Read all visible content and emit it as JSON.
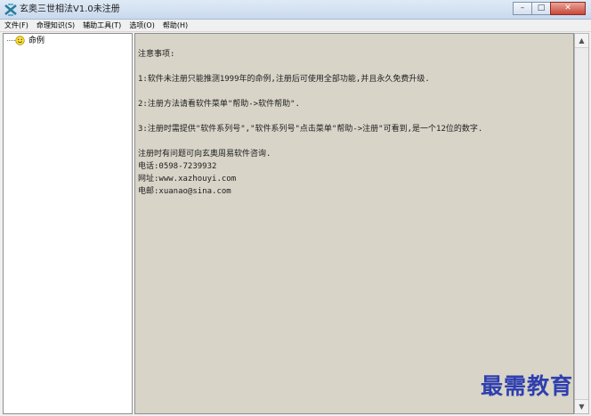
{
  "window": {
    "title": "玄奥三世相法V1.0未注册",
    "buttons": {
      "minimize": "–",
      "maximize": "□",
      "close": "✕"
    }
  },
  "menu": [
    {
      "label": "文件(F)"
    },
    {
      "label": "命理知识(S)"
    },
    {
      "label": "辅助工具(T)"
    },
    {
      "label": "选项(O)"
    },
    {
      "label": "帮助(H)"
    }
  ],
  "tree": {
    "node_label": "命例"
  },
  "notice": {
    "heading": "注意事项:",
    "line1": "1:软件未注册只能推测1999年的命例,注册后可使用全部功能,并且永久免费升级.",
    "line2": "2:注册方法请看软件菜单\"帮助->软件帮助\".",
    "line3": "3:注册时需提供\"软件系列号\",\"软件系列号\"点击菜单\"帮助->注册\"可看到,是一个12位的数字.",
    "contact_intro": "注册时有问题可向玄奥周易软件咨询.",
    "phone": "电话:0598-7239932",
    "website": "网址:www.xazhouyi.com",
    "email": "电邮:xuanao@sina.com"
  },
  "scrollbar": {
    "up": "▲",
    "down": "▼"
  },
  "watermark": "最需教育",
  "colors": {
    "notice_bg": "#d8d4c8",
    "watermark": "#2f3fae"
  }
}
